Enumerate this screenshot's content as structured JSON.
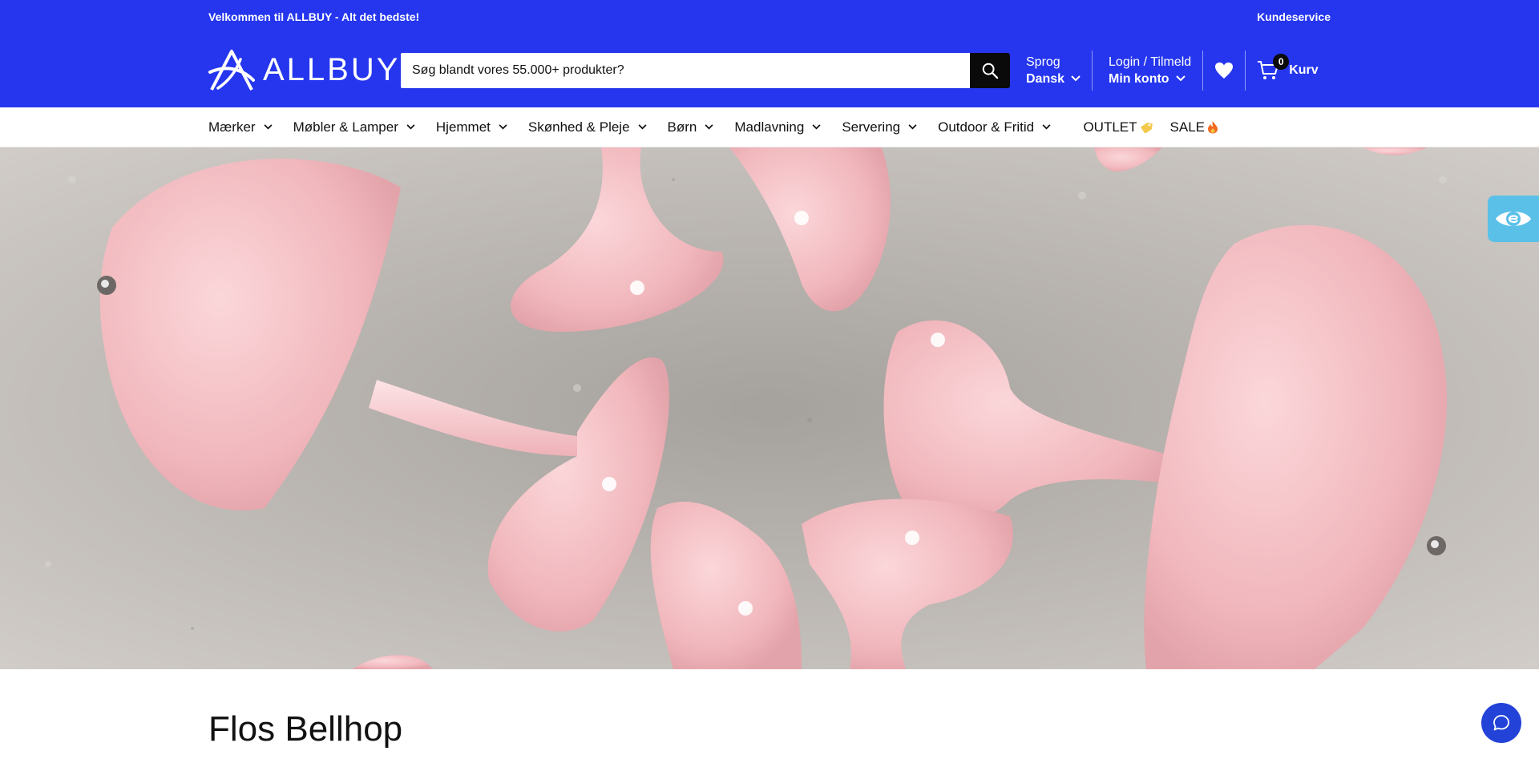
{
  "announcement": {
    "welcome": "Velkommen til ALLBUY - Alt det bedste!",
    "customer_service": "Kundeservice"
  },
  "header": {
    "logo_text": "ALLBUY",
    "search_placeholder": "Søg blandt vores 55.000+ produkter?",
    "language_label": "Sprog",
    "language_value": "Dansk",
    "account_label": "Login / Tilmeld",
    "account_value": "Min konto",
    "cart_count": "0",
    "cart_label": "Kurv"
  },
  "nav": {
    "items": [
      {
        "label": "Mærker"
      },
      {
        "label": "Møbler & Lamper"
      },
      {
        "label": "Hjemmet"
      },
      {
        "label": "Skønhed & Pleje"
      },
      {
        "label": "Børn"
      },
      {
        "label": "Madlavning"
      },
      {
        "label": "Servering"
      },
      {
        "label": "Outdoor & Fritid"
      }
    ],
    "outlet": "OUTLET",
    "sale": "SALE"
  },
  "page": {
    "title": "Flos Bellhop"
  },
  "colors": {
    "brand_blue": "#2536ee",
    "lamp_pink": "#f3c2c6",
    "background_gray": "#bdb8b4"
  },
  "icons": [
    "search-icon",
    "chevron-down-icon",
    "heart-icon",
    "cart-icon",
    "tag-icon",
    "flame-icon",
    "accessibility-eye-icon",
    "chat-icon"
  ]
}
